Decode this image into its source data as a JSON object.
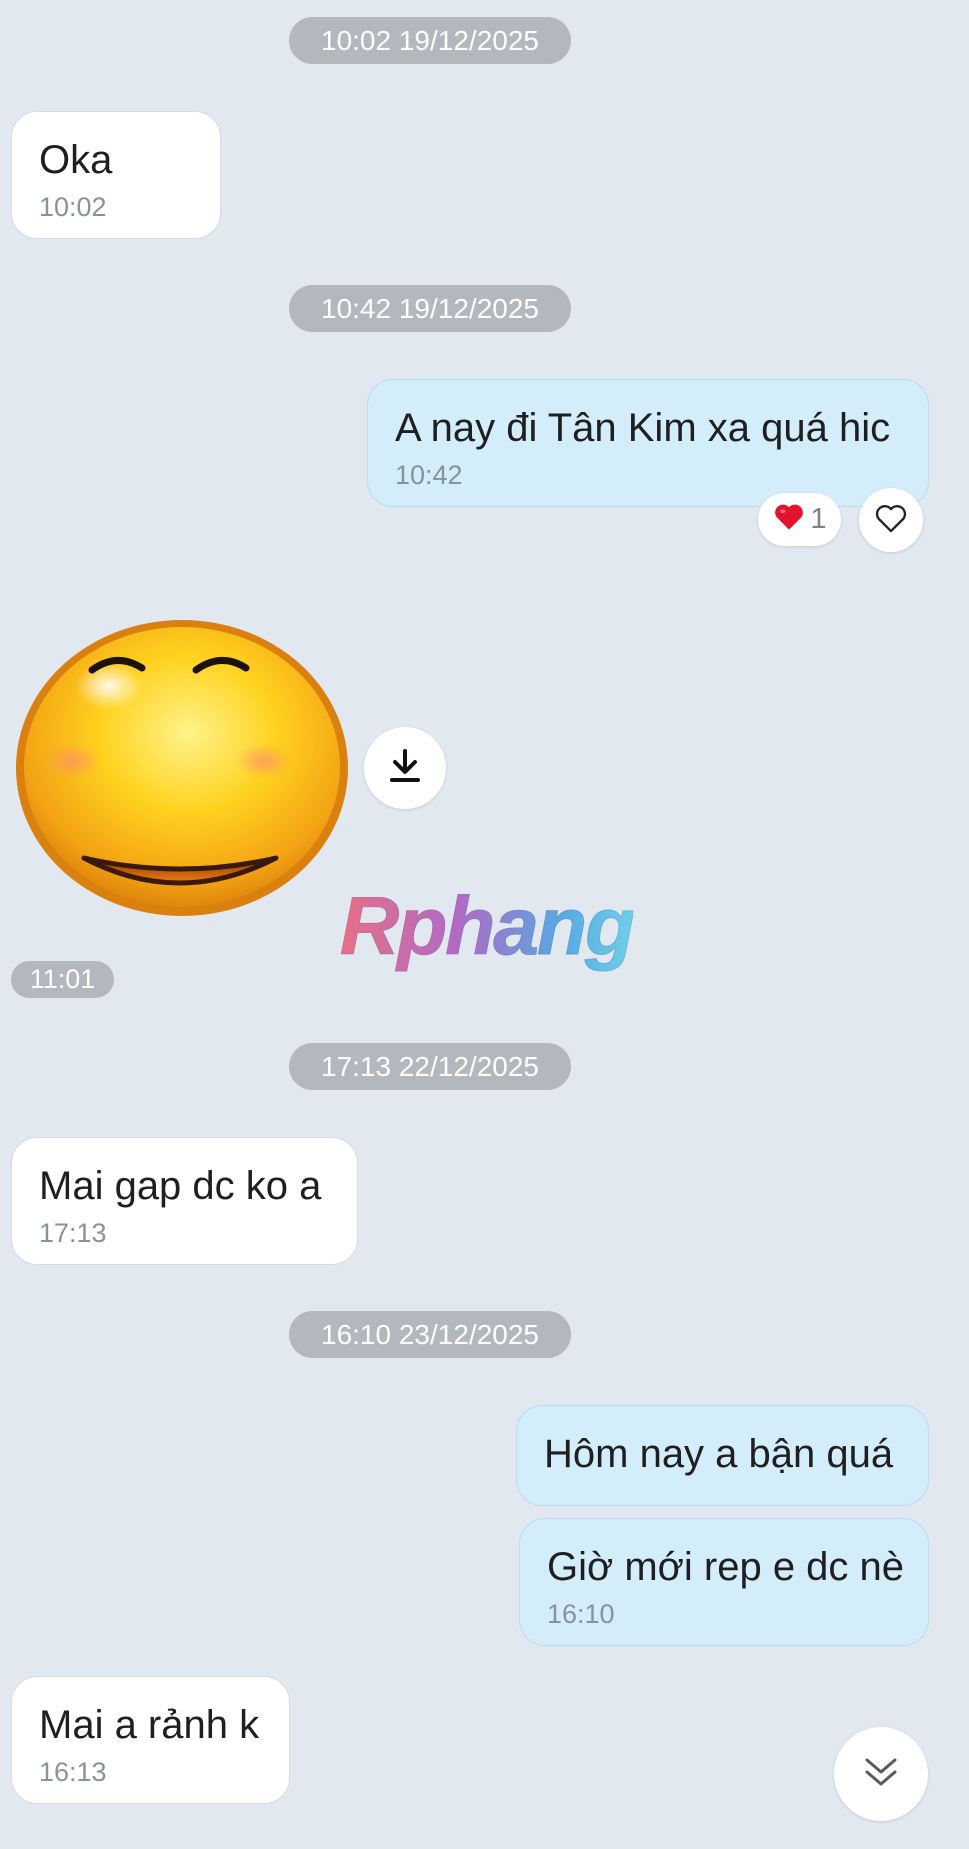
{
  "chat": {
    "date_separators": [
      "10:02 19/12/2025",
      "10:42 19/12/2025",
      "17:13 22/12/2025",
      "16:10 23/12/2025"
    ],
    "messages": [
      {
        "text": "Oka",
        "time": "10:02"
      },
      {
        "text": "A nay đi Tân Kim xa quá hic",
        "time": "10:42"
      },
      {
        "text": "Mai gap dc ko a",
        "time": "17:13"
      },
      {
        "text": "Hôm nay a bận quá"
      },
      {
        "text": "Giờ mới rep e dc nè",
        "time": "16:10"
      },
      {
        "text": "Mai a rảnh k",
        "time": "16:13"
      }
    ],
    "reaction": {
      "emoji": "❤️",
      "count": "1"
    },
    "sticker": {
      "time": "11:01",
      "watermark": "Rphang"
    }
  },
  "icons": {
    "heart_outline": "heart-icon",
    "download": "download-icon",
    "scroll_down": "chevron-double-down-icon"
  },
  "colors": {
    "background": "#e2e8f0",
    "incoming_bubble": "#ffffff",
    "outgoing_bubble": "#d4edfb",
    "pill": "#b3b8be"
  }
}
